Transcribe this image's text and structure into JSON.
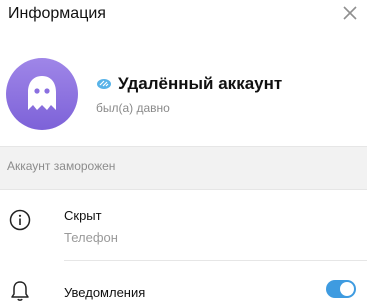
{
  "header": {
    "title": "Информация",
    "close_icon": "close-icon"
  },
  "profile": {
    "avatar_icon": "ghost-icon",
    "avatar_color": "#8a6fe0",
    "badge_icon": "verified-badge-icon",
    "name": "Удалённый аккаунт",
    "status": "был(а) давно"
  },
  "frozen": {
    "text": "Аккаунт заморожен"
  },
  "info": {
    "icon": "info-icon",
    "primary": "Скрыт",
    "secondary": "Телефон"
  },
  "notifications": {
    "icon": "bell-icon",
    "label": "Уведомления",
    "enabled": true,
    "toggle_color": "#3e9be0"
  }
}
